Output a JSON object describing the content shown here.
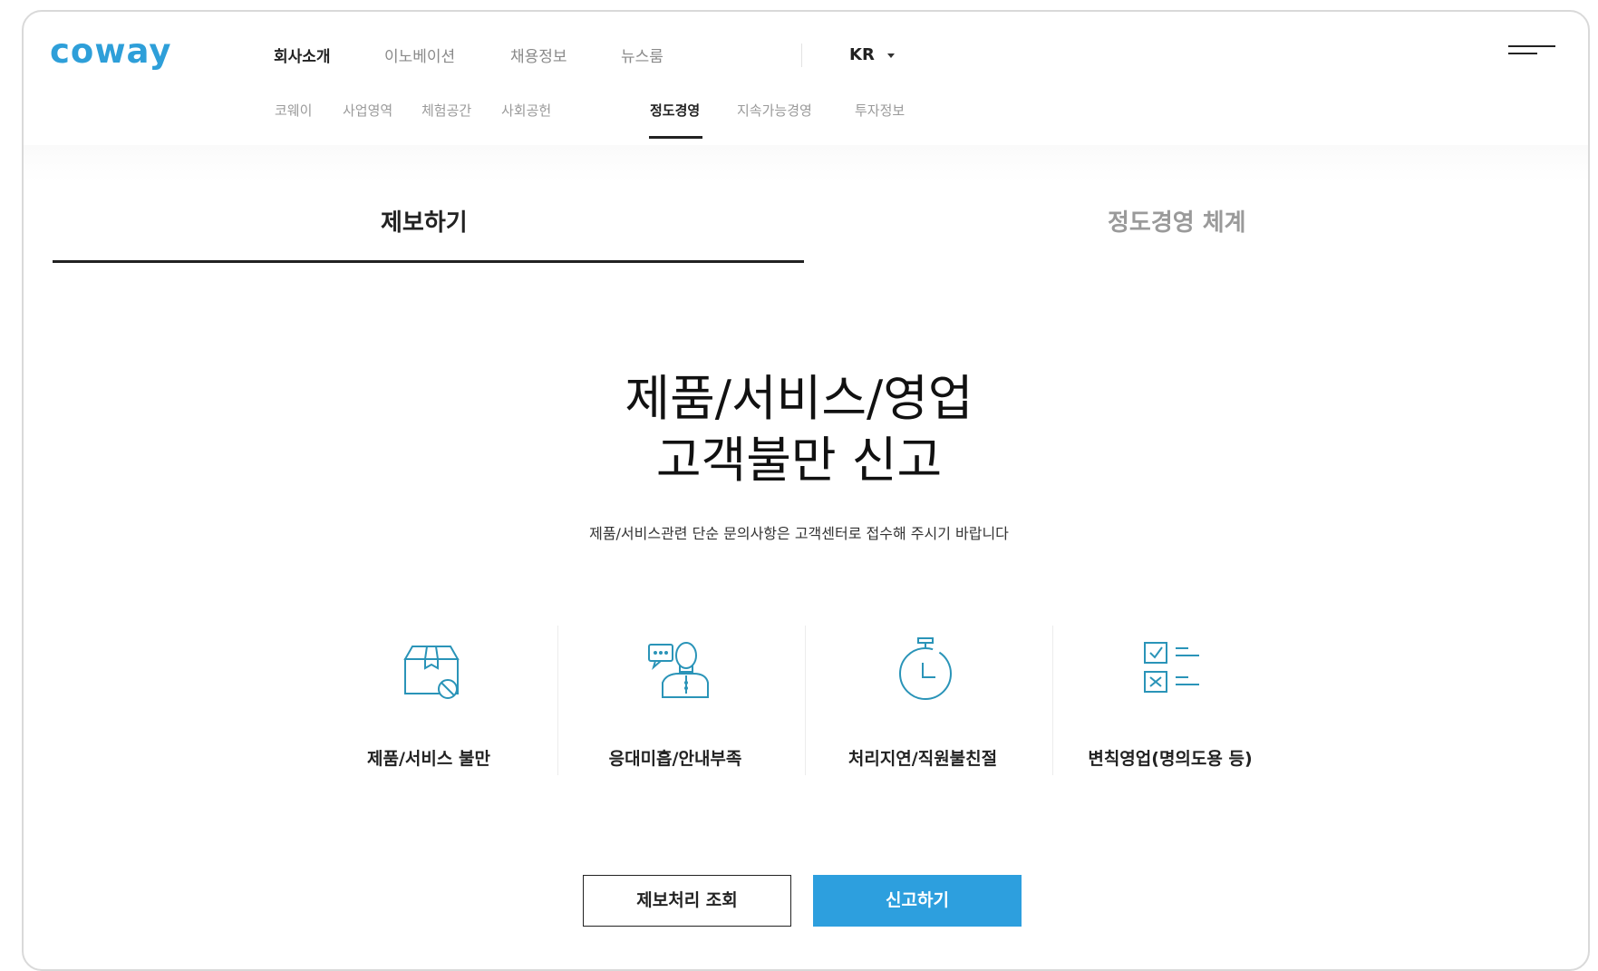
{
  "brand": {
    "logo_text": "coway",
    "color": "#2e9fd9"
  },
  "gnb": {
    "items": [
      {
        "label": "회사소개",
        "active": true
      },
      {
        "label": "이노베이션",
        "active": false
      },
      {
        "label": "채용정보",
        "active": false
      },
      {
        "label": "뉴스룸",
        "active": false
      }
    ],
    "language": "KR"
  },
  "lnb": {
    "items": [
      {
        "label": "코웨이"
      },
      {
        "label": "사업영역"
      },
      {
        "label": "체험공간"
      },
      {
        "label": "사회공헌"
      },
      {
        "label": "정도경영",
        "active": true
      },
      {
        "label": "지속가능경영"
      },
      {
        "label": "투자정보"
      }
    ]
  },
  "tabs": {
    "report": "제보하기",
    "system": "정도경영 체계"
  },
  "hero": {
    "title_line1": "제품/서비스/영업",
    "title_line2": "고객불만 신고",
    "subtitle": "제품/서비스관련 단순 문의사항은 고객센터로 접수해 주시기 바랍니다"
  },
  "categories": [
    {
      "label": "제품/서비스 불만",
      "icon": "box-prohibited-icon"
    },
    {
      "label": "응대미흡/안내부족",
      "icon": "agent-chat-icon"
    },
    {
      "label": "처리지연/직원불친절",
      "icon": "stopwatch-icon"
    },
    {
      "label": "변칙영업(명의도용 등)",
      "icon": "checklist-icon"
    }
  ],
  "buttons": {
    "lookup": "제보처리 조회",
    "report": "신고하기",
    "report_color": "#2d9fde"
  },
  "icon_color": "#2a94b8"
}
